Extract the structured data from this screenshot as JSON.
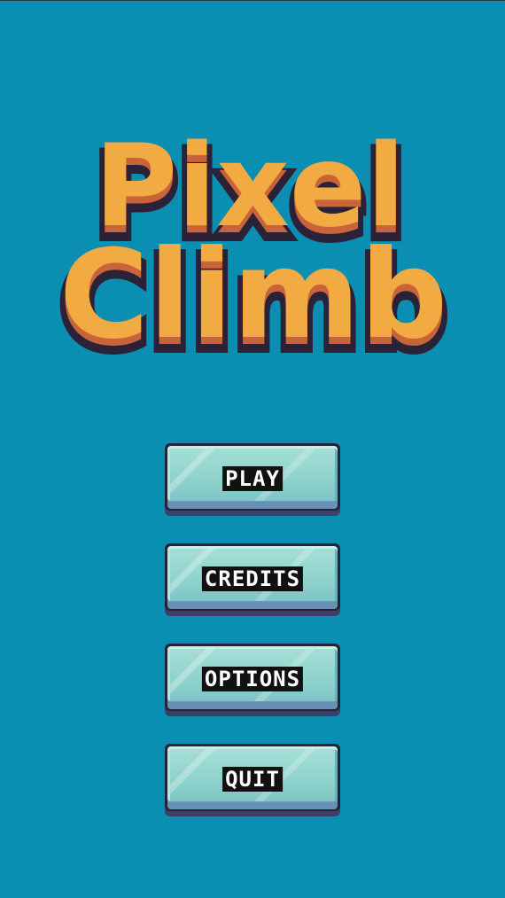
{
  "title": {
    "line1": "Pixel",
    "line2": "Climb"
  },
  "menu": {
    "items": [
      {
        "label": "PLAY"
      },
      {
        "label": "CREDITS"
      },
      {
        "label": "OPTIONS"
      },
      {
        "label": "QUIT"
      }
    ]
  },
  "colors": {
    "background": "#0a8eb2",
    "title_fill": "#f2aa42",
    "title_shadow": "#c8633a",
    "title_outline": "#2b2238",
    "button_face": "#8ed2cc",
    "button_shadow": "#3e3f66"
  }
}
